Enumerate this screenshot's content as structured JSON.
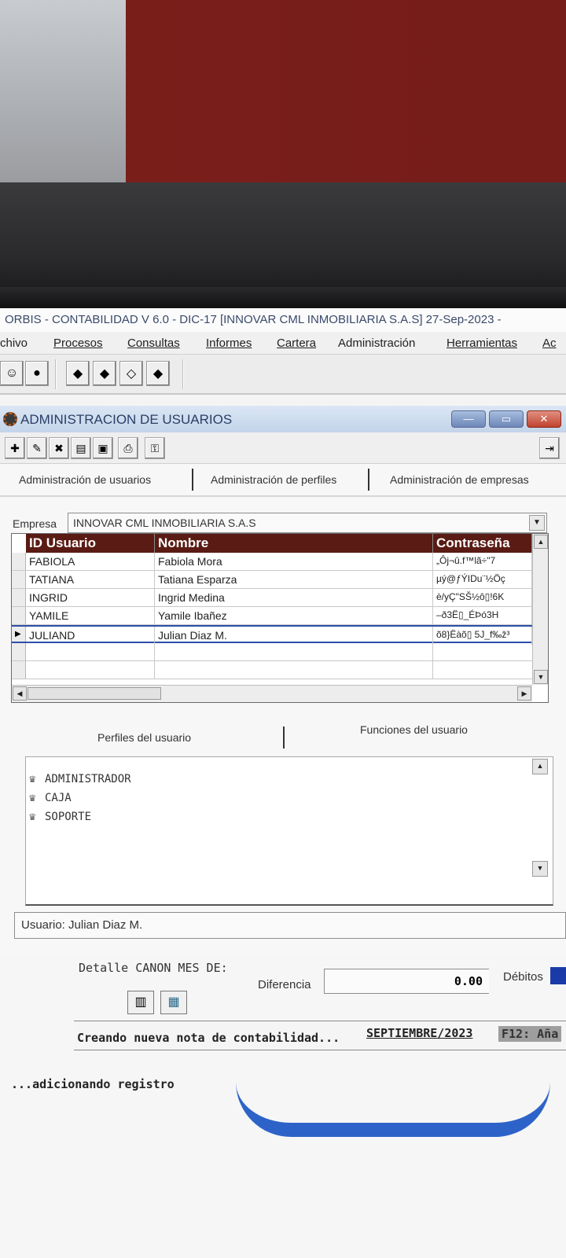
{
  "app": {
    "title": "ORBIS - CONTABILIDAD V 6.0 - DIC-17 [INNOVAR CML INMOBILIARIA S.A.S] 27-Sep-2023 -",
    "menu": [
      "chivo",
      "Procesos",
      "Consultas",
      "Informes",
      "Cartera",
      "Administración",
      "Herramientas",
      "Ac"
    ]
  },
  "child_window": {
    "title": "ADMINISTRACION DE USUARIOS",
    "tabs": [
      "Administración de usuarios",
      "Administración de perfiles",
      "Administración de empresas"
    ],
    "empresa_label": "Empresa",
    "empresa_value": "INNOVAR CML INMOBILIARIA S.A.S",
    "grid": {
      "columns": [
        "ID Usuario",
        "Nombre",
        "Contraseña"
      ],
      "rows": [
        {
          "id": "FABIOLA",
          "nombre": "Fabiola Mora",
          "pass": "„Ôj¬û.f™lã÷\"7"
        },
        {
          "id": "TATIANA",
          "nombre": "Tatiana Esparza",
          "pass": "µý@ƒÝIDu¨½Öç"
        },
        {
          "id": "INGRID",
          "nombre": "Ingrid Medina",
          "pass": "è/yÇ\"SŠ½ô▯!6K"
        },
        {
          "id": "YAMILE",
          "nombre": "Yamile Ibañez",
          "pass": "–ð3Ë▯_ÉÞó3H"
        },
        {
          "id": "JULIAND",
          "nombre": "Julian Diaz M.",
          "pass": "õ8}Ëàõ▯ 5J_f‰ž³"
        }
      ]
    },
    "subtabs": [
      "Perfiles del usuario",
      "Funciones del usuario"
    ],
    "profiles": [
      "ADMINISTRADOR",
      "CAJA",
      "SOPORTE"
    ],
    "status": "Usuario: Julian Diaz M."
  },
  "background_window": {
    "detalle": "Detalle CANON MES DE:",
    "diferencia_label": "Diferencia",
    "diferencia_value": "0.00",
    "debitos_label": "Débitos",
    "status_text": "Creando nueva nota de contabilidad...",
    "periodo": "SEPTIEMBRE/2023",
    "f12": "F12: Aña",
    "footer": "...adicionando registro"
  },
  "colors": {
    "grid_header": "#5a1b14",
    "selection_border": "#2d4fa8",
    "window_title": "#c3d4ea"
  }
}
